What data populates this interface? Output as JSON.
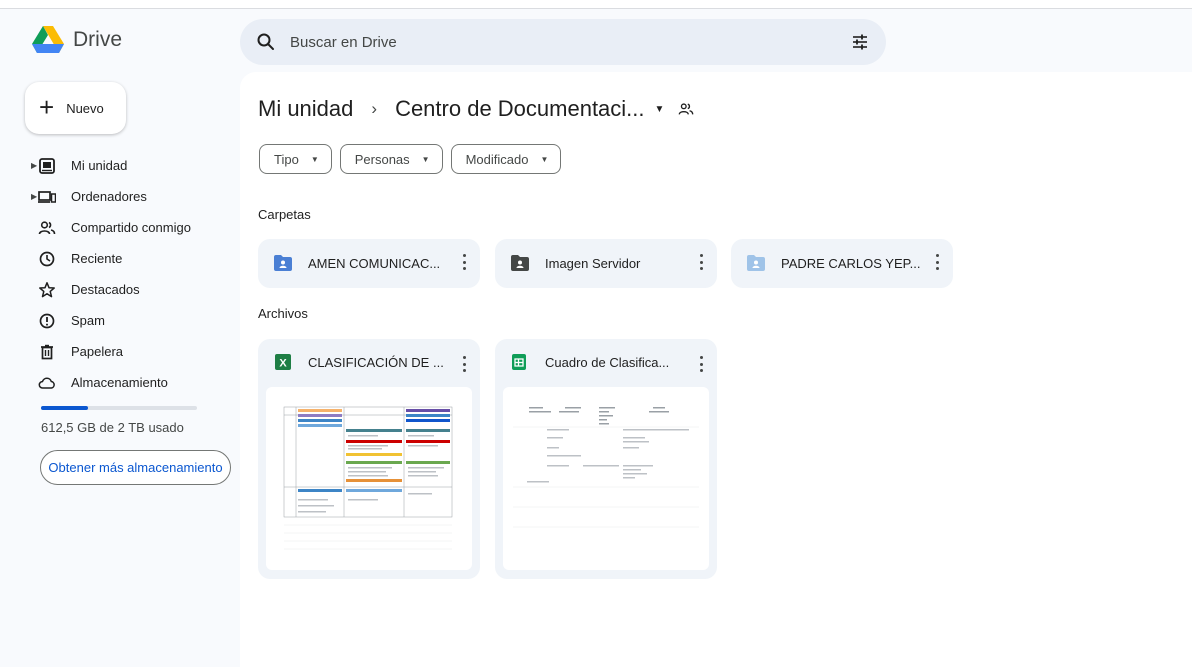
{
  "app": {
    "name": "Drive"
  },
  "search": {
    "placeholder": "Buscar en Drive"
  },
  "sidebar": {
    "new_label": "Nuevo",
    "items": [
      {
        "label": "Mi unidad",
        "icon": "my-drive-icon",
        "expandable": true
      },
      {
        "label": "Ordenadores",
        "icon": "computers-icon",
        "expandable": true
      },
      {
        "label": "Compartido conmigo",
        "icon": "shared-icon",
        "expandable": false
      },
      {
        "label": "Reciente",
        "icon": "clock-icon",
        "expandable": false
      },
      {
        "label": "Destacados",
        "icon": "star-icon",
        "expandable": false
      },
      {
        "label": "Spam",
        "icon": "spam-icon",
        "expandable": false
      },
      {
        "label": "Papelera",
        "icon": "trash-icon",
        "expandable": false
      },
      {
        "label": "Almacenamiento",
        "icon": "cloud-icon",
        "expandable": false
      }
    ],
    "storage": {
      "used_text": "612,5 GB de 2 TB usado",
      "used_fraction": 0.3
    },
    "more_storage_label": "Obtener más almacenamiento"
  },
  "breadcrumb": {
    "root": "Mi unidad",
    "separator": "›",
    "current": "Centro de Documentaci..."
  },
  "filters": [
    "Tipo",
    "Personas",
    "Modificado"
  ],
  "folders_section": "Carpetas",
  "folders": [
    {
      "name": "AMEN COMUNICAC...",
      "icon": "shared-folder-icon",
      "color": "#4a7fd4"
    },
    {
      "name": "Imagen Servidor",
      "icon": "shared-folder-icon",
      "color": "#444746"
    },
    {
      "name": "PADRE CARLOS YEP...",
      "icon": "shared-folder-icon",
      "color": "#9fc3e8"
    }
  ],
  "files_section": "Archivos",
  "files": [
    {
      "name": "CLASIFICACIÓN DE ...",
      "icon": "excel-icon",
      "color": "#1e7e45"
    },
    {
      "name": "Cuadro de Clasifica...",
      "icon": "sheets-icon",
      "color": "#0f9d58"
    }
  ],
  "colors": {
    "accent": "#0b57d0",
    "surface": "#f8fafd",
    "card": "#f0f4f9"
  }
}
